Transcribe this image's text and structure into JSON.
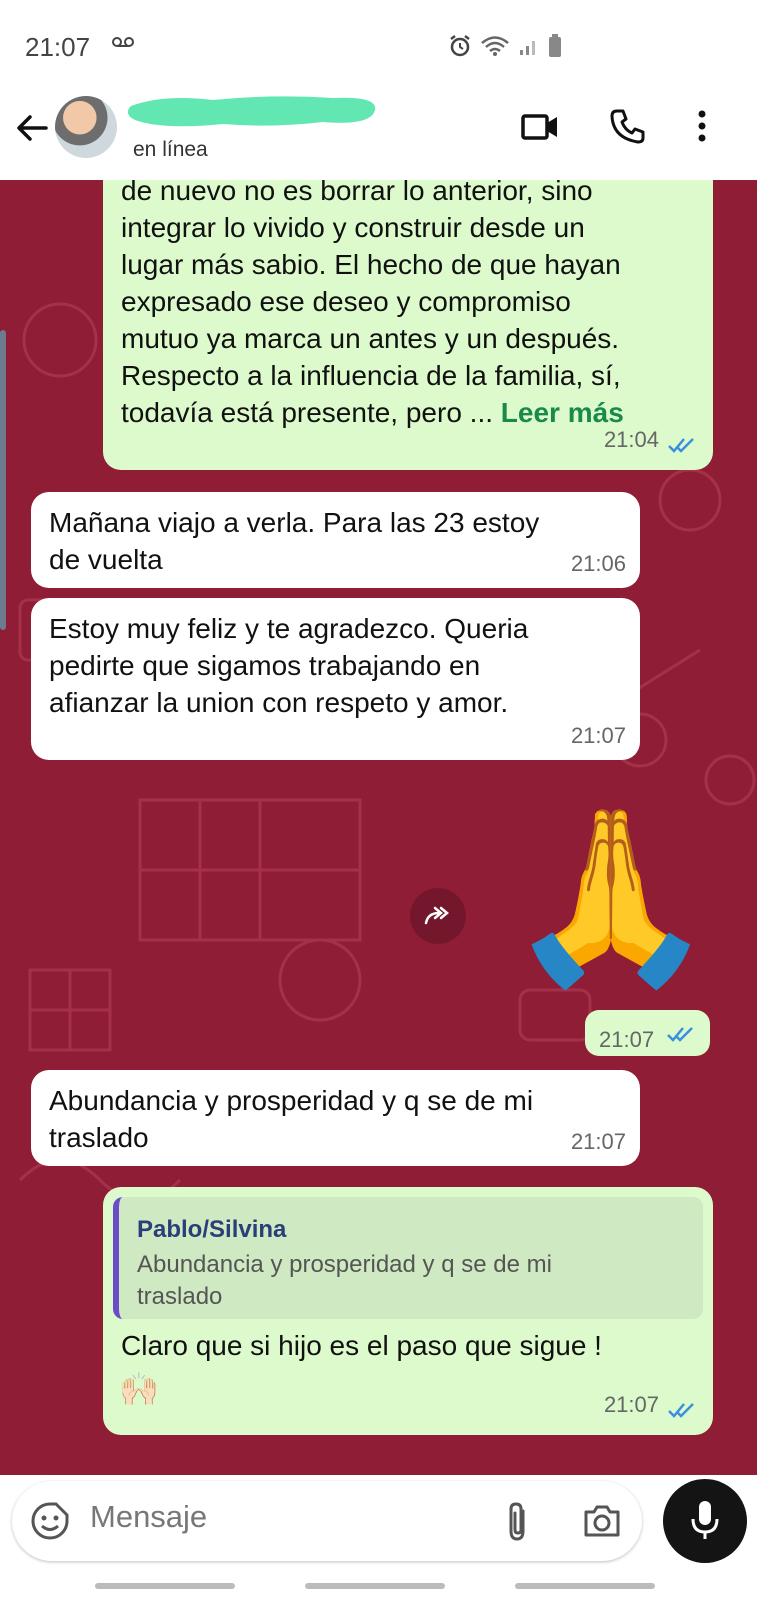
{
  "status_bar": {
    "time": "21:07"
  },
  "header": {
    "presence": "en línea"
  },
  "messages": {
    "m1": {
      "lines": [
        "de nuevo no es borrar lo anterior, sino",
        "integrar lo vivido y construir desde un",
        "lugar más sabio. El hecho de que hayan",
        "expresado ese deseo y compromiso",
        "mutuo ya marca un antes y un después.",
        "Respecto a la influencia de la familia, sí,",
        "todavía está presente, pero ..."
      ],
      "read_more": "Leer más",
      "time": "21:04"
    },
    "m2": {
      "lines": [
        "Mañana viajo a verla. Para las 23 estoy",
        "de vuelta"
      ],
      "time": "21:06"
    },
    "m3": {
      "lines": [
        "Estoy muy feliz y te agradezco. Queria",
        "pedirte que sigamos trabajando en",
        "afianzar la union con respeto y amor."
      ],
      "time": "21:07"
    },
    "m4": {
      "emoji": "🙏",
      "time": "21:07"
    },
    "m5": {
      "lines": [
        "Abundancia y prosperidad y q se de mi",
        "traslado"
      ],
      "time": "21:07"
    },
    "m6": {
      "quote_author": "Pablo/Silvina",
      "quote_lines": [
        "Abundancia y prosperidad y q se de mi",
        "traslado"
      ],
      "text": "Claro que si hijo es el paso que sigue !",
      "emoji": "🙌🏻",
      "time": "21:07"
    }
  },
  "input": {
    "placeholder": "Mensaje"
  },
  "colors": {
    "chat_bg": "#8f1d36",
    "outgoing": "#dcfacb",
    "incoming": "#ffffff",
    "read_tick": "#3b8fe0",
    "read_more": "#1a8a4c"
  }
}
